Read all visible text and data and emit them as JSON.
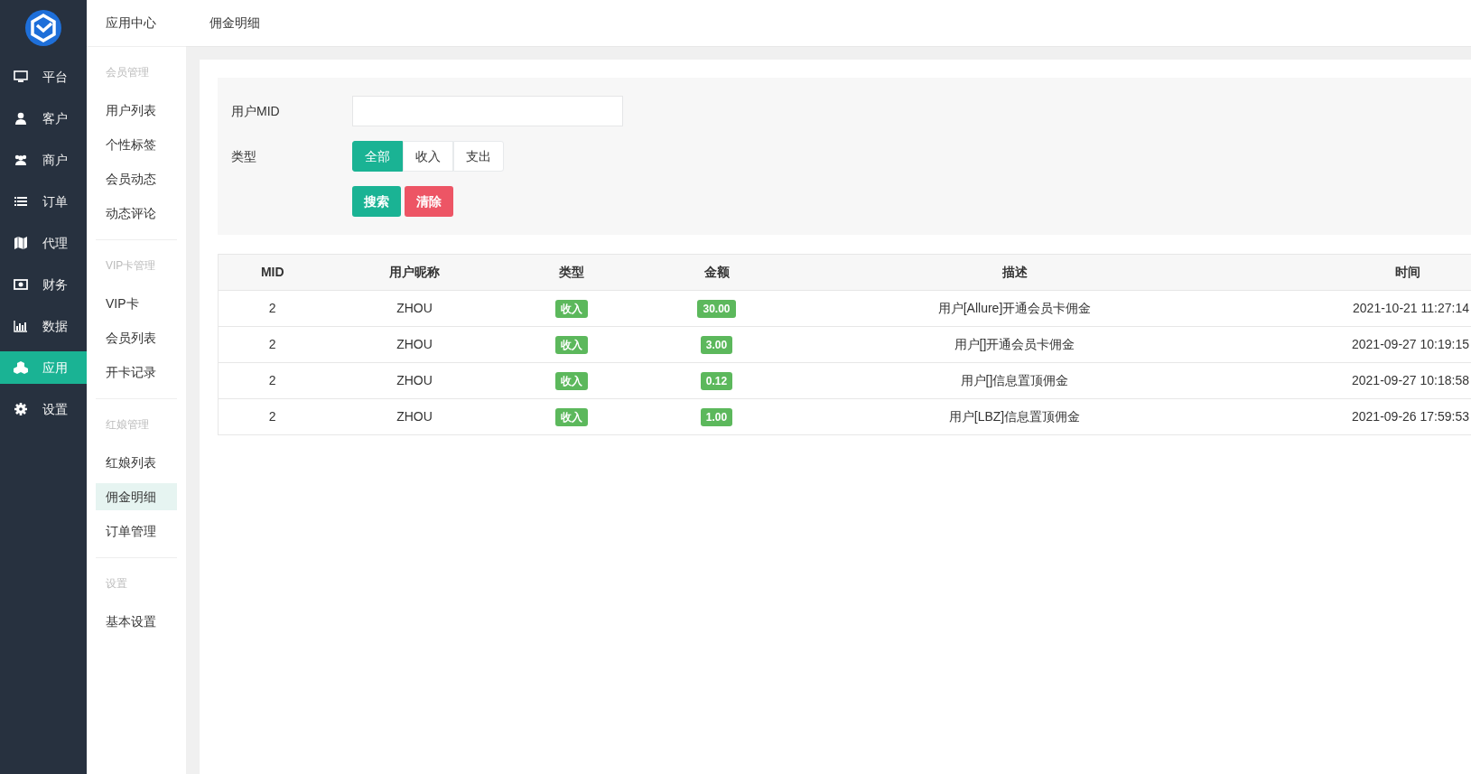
{
  "nav": {
    "items": [
      {
        "label": "平台",
        "selected": false
      },
      {
        "label": "客户",
        "selected": false
      },
      {
        "label": "商户",
        "selected": false
      },
      {
        "label": "订单",
        "selected": false
      },
      {
        "label": "代理",
        "selected": false
      },
      {
        "label": "财务",
        "selected": false
      },
      {
        "label": "数据",
        "selected": false
      },
      {
        "label": "应用",
        "selected": true
      },
      {
        "label": "设置",
        "selected": false
      }
    ]
  },
  "submenu": {
    "title": "应用中心",
    "groups": [
      {
        "title": "会员管理",
        "items": [
          {
            "label": "用户列表",
            "selected": false
          },
          {
            "label": "个性标签",
            "selected": false
          },
          {
            "label": "会员动态",
            "selected": false
          },
          {
            "label": "动态评论",
            "selected": false
          }
        ]
      },
      {
        "title": "VIP卡管理",
        "items": [
          {
            "label": "VIP卡",
            "selected": false
          },
          {
            "label": "会员列表",
            "selected": false
          },
          {
            "label": "开卡记录",
            "selected": false
          }
        ]
      },
      {
        "title": "红娘管理",
        "items": [
          {
            "label": "红娘列表",
            "selected": false
          },
          {
            "label": "佣金明细",
            "selected": true
          },
          {
            "label": "订单管理",
            "selected": false
          }
        ]
      },
      {
        "title": "设置",
        "items": [
          {
            "label": "基本设置",
            "selected": false
          }
        ]
      }
    ]
  },
  "breadcrumb": "佣金明细",
  "filter": {
    "mid_label": "用户MID",
    "type_label": "类型",
    "type_options": [
      {
        "label": "全部",
        "selected": true
      },
      {
        "label": "收入",
        "selected": false
      },
      {
        "label": "支出",
        "selected": false
      }
    ],
    "buttons": [
      {
        "label": "搜索",
        "kind": "primary"
      },
      {
        "label": "清除",
        "kind": "danger"
      }
    ]
  },
  "table": {
    "columns": [
      "MID",
      "用户昵称",
      "类型",
      "金额",
      "描述",
      "时间"
    ],
    "rows": [
      {
        "mid": "2",
        "nickname": "ZHOU",
        "type": "收入",
        "amount": "30.00",
        "description": "用户[Allure]开通会员卡佣金",
        "time": "2021-10-21 11:27:14"
      },
      {
        "mid": "2",
        "nickname": "ZHOU",
        "type": "收入",
        "amount": "3.00",
        "description": "用户[]开通会员卡佣金",
        "time": "2021-09-27 10:19:15"
      },
      {
        "mid": "2",
        "nickname": "ZHOU",
        "type": "收入",
        "amount": "0.12",
        "description": "用户[]信息置顶佣金",
        "time": "2021-09-27 10:18:58"
      },
      {
        "mid": "2",
        "nickname": "ZHOU",
        "type": "收入",
        "amount": "1.00",
        "description": "用户[LBZ]信息置顶佣金",
        "time": "2021-09-26 17:59:53"
      }
    ]
  }
}
